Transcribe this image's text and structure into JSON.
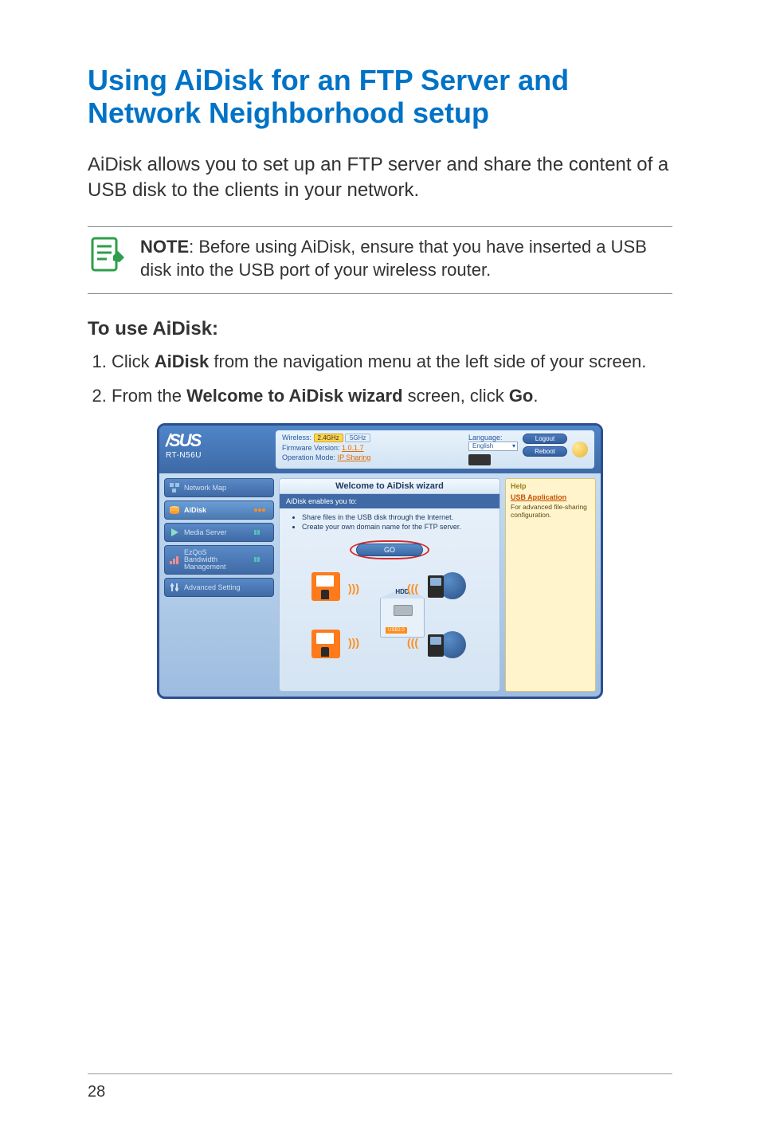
{
  "title": "Using AiDisk for an FTP Server and Network Neighborhood setup",
  "intro": "AiDisk allows you to set up an FTP server and share the content of a USB disk to the clients in your network.",
  "note": {
    "label": "NOTE",
    "text": ":   Before using AiDisk, ensure that you have inserted a USB disk into the USB port of your wireless router."
  },
  "subhead": "To use AiDisk:",
  "steps": [
    {
      "n": "1.",
      "pre": "Click ",
      "bold": "AiDisk",
      "post": " from the navigation menu at the left side of your screen."
    },
    {
      "n": "2.",
      "pre": "From the ",
      "bold": "Welcome to AiDisk wizard",
      "mid": " screen, click ",
      "bold2": "Go",
      "post": "."
    }
  ],
  "shot": {
    "brand": "/SUS",
    "model": "RT-N56U",
    "header": {
      "wireless_label": "Wireless:",
      "band_24": "2.4GHz",
      "band_5": "5GHz",
      "fw_label": "Firmware Version:",
      "fw_value": "1.0.1.7",
      "opmode_label": "Operation Mode:",
      "opmode_value": "IP Sharing",
      "lang_label": "Language:",
      "lang_value": "English",
      "logout": "Logout",
      "reboot": "Reboot"
    },
    "sidebar": [
      {
        "label": "Network Map",
        "icon": "map"
      },
      {
        "label": "AiDisk",
        "icon": "disk",
        "active": true,
        "dots": "orange"
      },
      {
        "label": "Media Server",
        "icon": "media",
        "dots": "teal"
      },
      {
        "label": "EzQoS\nBandwidth\nManagement",
        "icon": "qos",
        "dots": "teal"
      },
      {
        "label": "Advanced Setting",
        "icon": "adv"
      }
    ],
    "wizard": {
      "title": "Welcome to AiDisk wizard",
      "subtitle": "AiDisk enables you to:",
      "bullets": [
        "Share files in the USB disk through the Internet.",
        "Create your own domain name for the FTP server."
      ],
      "go": "GO",
      "hdd": "HDD",
      "usb": "USB2.0"
    },
    "help": {
      "heading": "Help",
      "link": "USB Application",
      "text": "For advanced file-sharing configuration."
    }
  },
  "page_number": "28"
}
